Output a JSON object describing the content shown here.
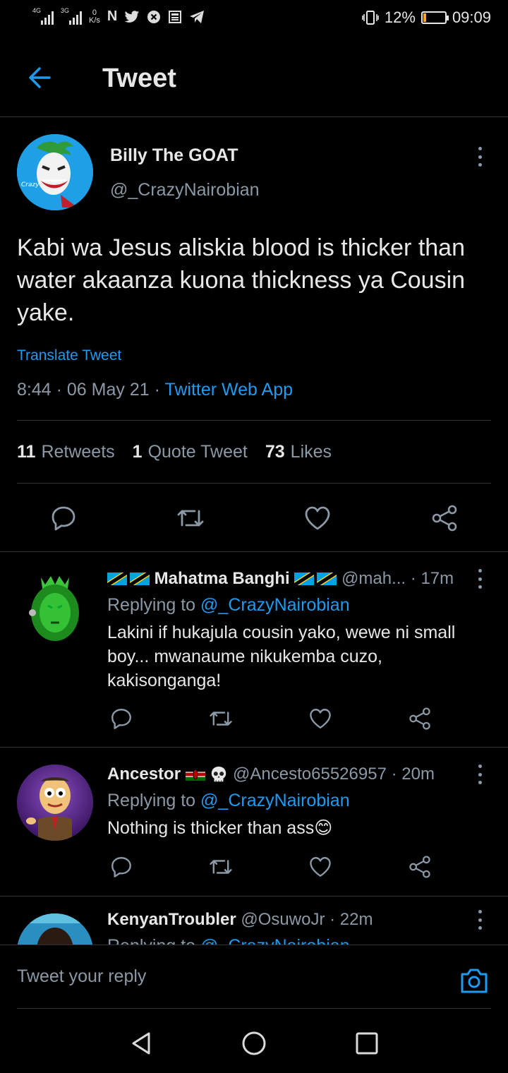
{
  "status_bar": {
    "net1": "4G",
    "net2": "3G",
    "speed_value": "0",
    "speed_unit": "K/s",
    "battery": "12%",
    "time": "09:09",
    "battery_level": 0.12
  },
  "header": {
    "title": "Tweet"
  },
  "tweet": {
    "author_name": "Billy The GOAT",
    "author_handle": "@_CrazyNairobian",
    "text": "Kabi wa Jesus aliskia blood is thicker than water akaanza kuona thickness ya Cousin yake.",
    "translate": "Translate Tweet",
    "time": "8:44",
    "date": "06 May 21",
    "source": "Twitter Web App",
    "stats": {
      "retweets_count": "11",
      "retweets_label": "Retweets",
      "quotes_count": "1",
      "quotes_label": "Quote Tweet",
      "likes_count": "73",
      "likes_label": "Likes"
    }
  },
  "replies": [
    {
      "name": "Mahatma Banghi",
      "handle": "@mah...",
      "time": "17m",
      "replying_prefix": "Replying to",
      "replying_to": "@_CrazyNairobian",
      "text": "Lakini if hukajula cousin yako, wewe ni small boy... mwanaume nikukemba cuzo, kakisonganga!"
    },
    {
      "name": "Ancestor",
      "handle": "@Ancesto65526957",
      "time": "20m",
      "replying_prefix": "Replying to",
      "replying_to": "@_CrazyNairobian",
      "text": "Nothing is thicker than ass😊"
    },
    {
      "name": "KenyanTroubler",
      "handle": "@OsuwoJr",
      "time": "22m",
      "replying_prefix": "Replying to",
      "replying_to": "@_CrazyNairobian"
    }
  ],
  "reply_bar": {
    "placeholder": "Tweet your reply"
  },
  "colors": {
    "accent": "#1d9bf0",
    "background": "#000000",
    "secondary_text": "#8b98a5",
    "divider": "#2f3336"
  }
}
